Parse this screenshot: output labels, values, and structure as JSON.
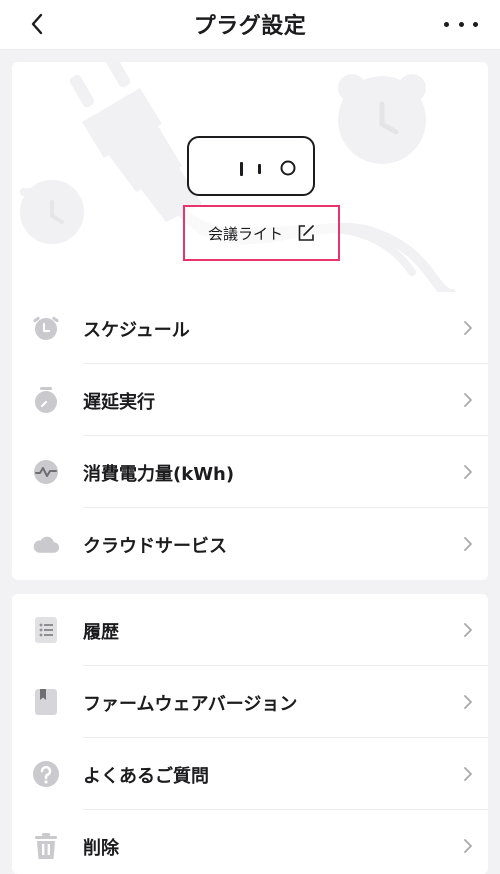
{
  "header": {
    "title": "プラグ設定",
    "back_icon": "chevron-left-icon",
    "more_icon": "more-horizontal-icon"
  },
  "device": {
    "name": "会議ライト",
    "edit_icon": "edit-icon",
    "highlight_color": "#e8336d"
  },
  "menu_primary": [
    {
      "label": "スケジュール",
      "icon": "alarm-clock-icon"
    },
    {
      "label": "遅延実行",
      "icon": "timer-icon"
    },
    {
      "label": "消費電力量(kWh)",
      "icon": "power-wave-icon"
    },
    {
      "label": "クラウドサービス",
      "icon": "cloud-icon"
    }
  ],
  "menu_secondary": [
    {
      "label": "履歴",
      "icon": "history-list-icon"
    },
    {
      "label": "ファームウェアバージョン",
      "icon": "firmware-book-icon"
    },
    {
      "label": "よくあるご質問",
      "icon": "question-icon"
    },
    {
      "label": "削除",
      "icon": "trash-icon"
    }
  ],
  "colors": {
    "icon_gray": "#c9c9ce",
    "chevron_gray": "#a8a8ad",
    "background": "#f2f2f4"
  }
}
